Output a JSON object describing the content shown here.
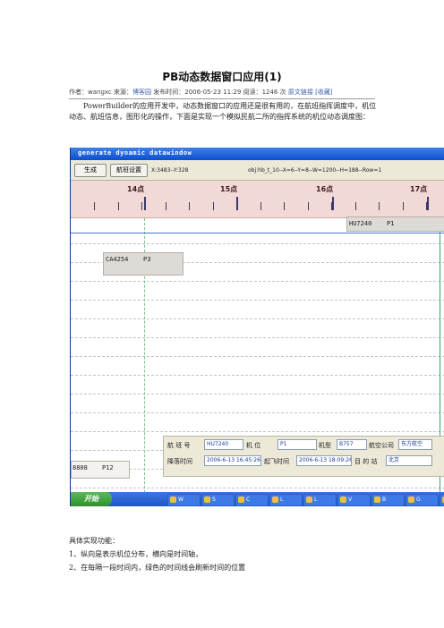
{
  "article": {
    "title": "PB动态数据窗口应用(1)",
    "meta_prefix": "作者：",
    "author": "wangxc",
    "source_label": "来源：",
    "source": "博客园",
    "published_label": "发布时间：",
    "published": "2006-05-23 11:29",
    "reads_label": "阅读：",
    "reads": "1246",
    "reads_unit": "次",
    "original_link": "原文链接",
    "favorite": "[收藏]",
    "intro": "PowerBuilder的应用开发中，动态数据窗口的应用还是很有用的，在航班指挥调度中，机位动态、航班信息，图形化的操作，下面是实现一个模拟民航二所的指挥系统的机位动态调度图："
  },
  "screenshot": {
    "window_title": "generate dynamic datawindow",
    "toolbar": {
      "generate_button": "生成",
      "settings_button": "航班设置",
      "coords": "X:3483--Y:328",
      "object_info": "obj:hb_t_10--X=6--Y=8--W=1200--H=188--Row=1"
    },
    "hours": [
      "14点",
      "15点",
      "16点",
      "17点"
    ],
    "flights": [
      {
        "code": "HU7240",
        "stand": "P1"
      },
      {
        "code": "CA4254",
        "stand": "P3"
      },
      {
        "code": "8808",
        "stand": "P12"
      }
    ],
    "detail": {
      "flight_no_label": "航 班 号",
      "flight_no": "HU7240",
      "stand_label": "机  位",
      "stand": "P1",
      "type_label": "机型",
      "type": "B757",
      "airline_label": "航空公司",
      "airline": "东方航空",
      "land_label": "降落时间",
      "land_time": "2006-6-13 16:45:26",
      "takeoff_label": "起飞时间",
      "takeoff_time": "2006-6-13 18:09:26",
      "dest_label": "目 的 站",
      "dest": "北京"
    },
    "taskbar": {
      "start": "开始",
      "items": [
        "W",
        "S",
        "C",
        "L",
        "L",
        "V",
        "B",
        "G",
        "P"
      ]
    }
  },
  "features": {
    "heading": "具体实现功能：",
    "items": [
      "1、纵向是表示机位分布，横向是时间轴，",
      "2、在每隔一段时间内，绿色的时间线会刷新时间的位置"
    ]
  }
}
